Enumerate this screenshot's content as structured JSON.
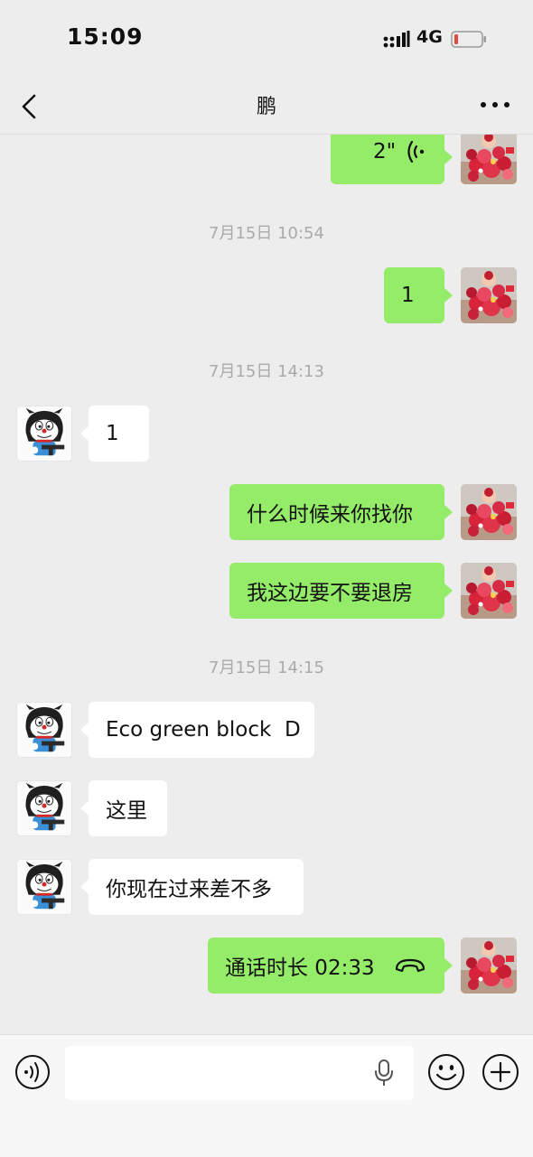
{
  "status_bar": {
    "time": "15:09",
    "network": "4G",
    "battery_color": "#e24a3c"
  },
  "nav": {
    "title": "鹏",
    "back_icon": "chevron-left-icon",
    "more_icon": "more-dots-icon"
  },
  "messages": [
    {
      "type": "voice",
      "from": "me",
      "duration": "2\""
    },
    {
      "type": "timestamp",
      "text": "7月15日 10:54"
    },
    {
      "type": "text",
      "from": "me",
      "text": "1"
    },
    {
      "type": "timestamp",
      "text": "7月15日 14:13"
    },
    {
      "type": "text",
      "from": "peer",
      "text": "1"
    },
    {
      "type": "text",
      "from": "me",
      "text": "什么时候来你找你"
    },
    {
      "type": "text",
      "from": "me",
      "text": "我这边要不要退房"
    },
    {
      "type": "timestamp",
      "text": "7月15日 14:15"
    },
    {
      "type": "text",
      "from": "peer",
      "text": "Eco green block  D"
    },
    {
      "type": "text",
      "from": "peer",
      "text": "这里"
    },
    {
      "type": "text",
      "from": "peer",
      "text": "你现在过来差不多"
    },
    {
      "type": "call",
      "from": "me",
      "text": "通话时长 02:33"
    }
  ],
  "input_bar": {
    "voice_icon": "voice-mode-icon",
    "mic_icon": "microphone-icon",
    "emoji_icon": "emoji-icon",
    "plus_icon": "plus-icon"
  },
  "colors": {
    "background": "#ededed",
    "my_bubble": "#95ec69",
    "peer_bubble": "#ffffff",
    "timestamp": "#aaaaaa"
  }
}
